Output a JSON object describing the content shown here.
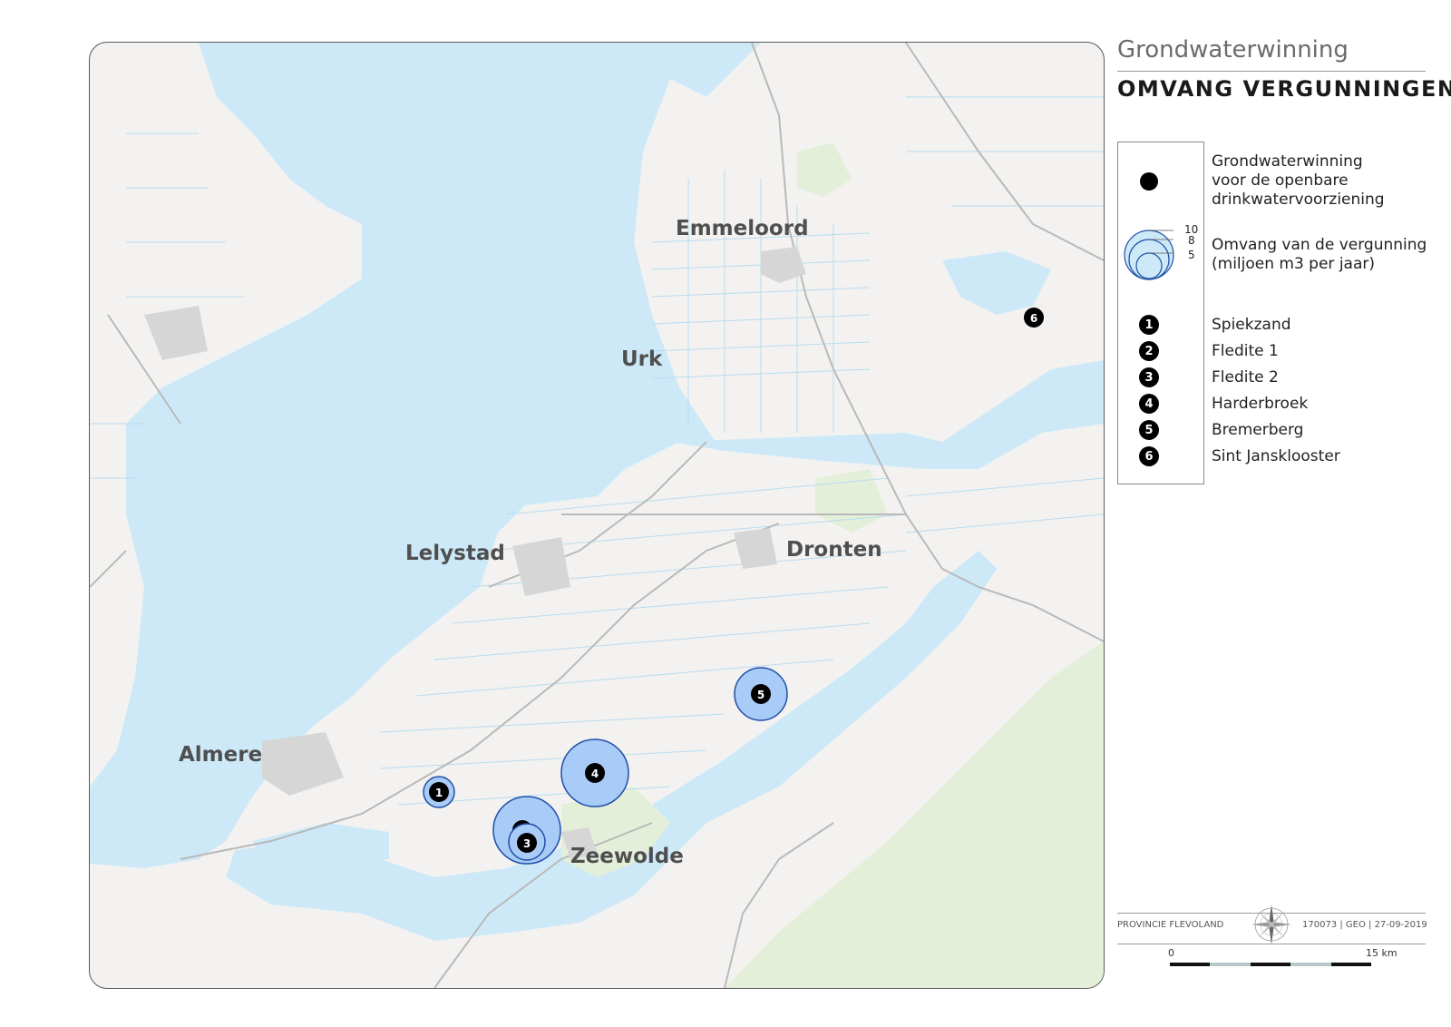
{
  "header": {
    "title": "Grondwaterwinning",
    "subtitle": "OMVANG VERGUNNINGEN"
  },
  "map": {
    "colors": {
      "water": "#cde9f8",
      "land": "#f3f2f0",
      "forest": "#e4efd9",
      "road": "#b9b9b9",
      "ditch": "#b7dcf1",
      "marker_fill": "#a9cbf7",
      "marker_stroke": "#1f4fa8"
    },
    "cities": [
      "Emmeloord",
      "Urk",
      "Lelystad",
      "Dronten",
      "Almere",
      "Zeewolde"
    ],
    "permit_markers": [
      {
        "id": "1",
        "name": "Spiekzand"
      },
      {
        "id": "2",
        "name": "Fledite 1"
      },
      {
        "id": "3",
        "name": "Fledite 2"
      },
      {
        "id": "4",
        "name": "Harderbroek"
      },
      {
        "id": "5",
        "name": "Bremerberg"
      },
      {
        "id": "6",
        "name": "Sint Jansklooster"
      }
    ]
  },
  "legend": {
    "point_label": "Grondwaterwinning\nvoor de openbare\ndrinkwatervoorziening",
    "size_label": "Omvang van de vergunning\n(miljoen m3 per jaar)",
    "size_values": [
      "10",
      "8",
      "5"
    ],
    "items": [
      {
        "id": "1",
        "label": "Spiekzand"
      },
      {
        "id": "2",
        "label": "Fledite 1"
      },
      {
        "id": "3",
        "label": "Fledite 2"
      },
      {
        "id": "4",
        "label": "Harderbroek"
      },
      {
        "id": "5",
        "label": "Bremerberg"
      },
      {
        "id": "6",
        "label": "Sint Jansklooster"
      }
    ]
  },
  "footer": {
    "organization": "PROVINCIE FLEVOLAND",
    "code": "170073 | GEO | 27-09-2019",
    "scale_start": "0",
    "scale_end": "15 km"
  }
}
